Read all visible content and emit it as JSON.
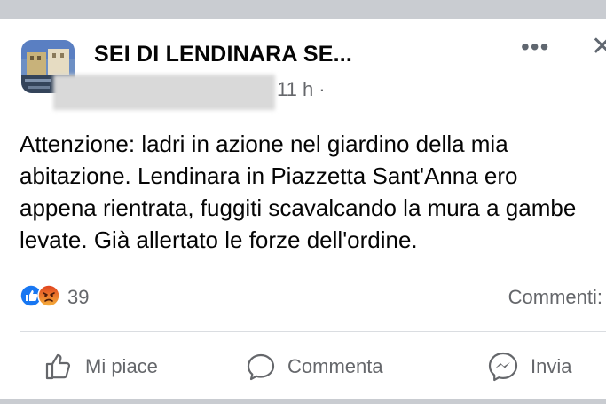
{
  "post": {
    "group_name": "SEI DI LENDINARA SE...",
    "timestamp": "11 h ·",
    "body": "Attenzione: ladri in azione nel giardino della mia abitazione. Lendinara in Piazzetta Sant'Anna ero appena rientrata, fuggiti scavalcando la mura a gambe levate. Già allertato le forze dell'ordine.",
    "more_label": "•••",
    "close_label": "✕"
  },
  "reactions": {
    "types": [
      "like-icon",
      "angry-icon"
    ],
    "count": "39",
    "comments_label": "Commenti:"
  },
  "actions": {
    "like_label": "Mi piace",
    "comment_label": "Commenta",
    "share_label": "Invia"
  },
  "colors": {
    "like_blue": "#1877f2",
    "angry_orange": "#e9710f",
    "secondary_text": "#65676b",
    "background_gray": "#c9ccd1"
  }
}
